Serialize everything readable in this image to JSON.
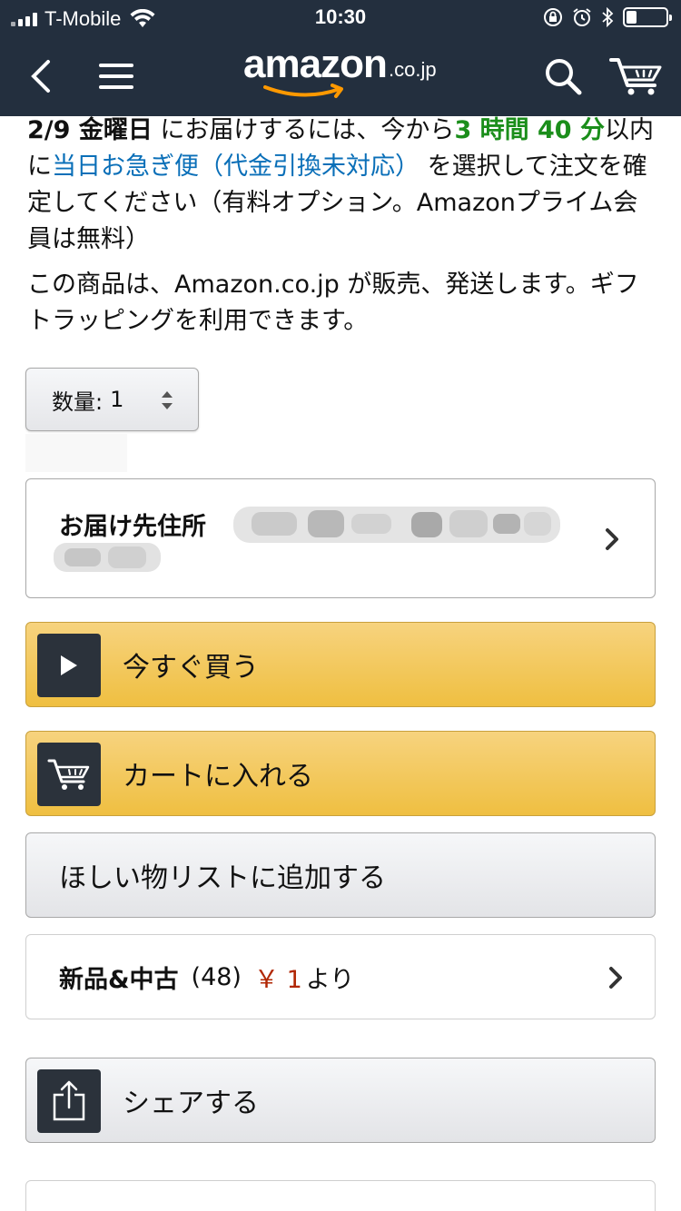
{
  "status_bar": {
    "carrier": "T-Mobile",
    "time": "10:30",
    "battery_level": 0.25
  },
  "header": {
    "logo_word": "amazon",
    "logo_tld": ".co.jp",
    "icons": [
      "back-icon",
      "menu-icon",
      "search-icon",
      "cart-icon"
    ]
  },
  "delivery": {
    "date": "2/9 金曜日",
    "text1": " にお届けするには、今から",
    "countdown": "3 時間 40 分",
    "text2": "以内に",
    "option_link": "当日お急ぎ便（代金引換未対応）",
    "text3": " を選択して注文を確定してください（有料オプション。Amazonプライム会員は無料）"
  },
  "seller_note": "この商品は、Amazon.co.jp が販売、発送します。ギフトラッピングを利用できます。",
  "quantity": {
    "label": "数量:",
    "value": "1"
  },
  "address": {
    "label": "お届け先住所"
  },
  "buttons": {
    "buy_now": "今すぐ買う",
    "add_to_cart": "カートに入れる",
    "wishlist": "ほしい物リストに追加する",
    "share": "シェアする"
  },
  "new_used": {
    "label": "新品&中古",
    "count": "(48)",
    "price": "￥ 1",
    "suffix": "より"
  },
  "colors": {
    "header_bg": "#232f3e",
    "button_yellow": "#f0c14b",
    "countdown_green": "#1b8e1b",
    "link_blue": "#0a6fb8",
    "price_red": "#b12704"
  }
}
